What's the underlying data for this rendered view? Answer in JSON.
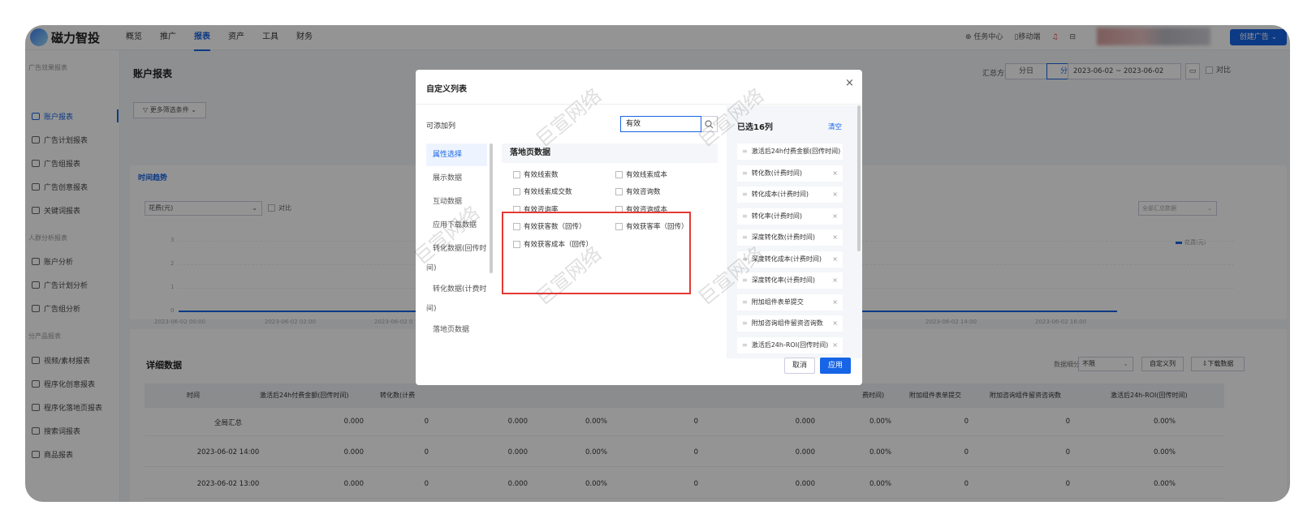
{
  "topbar": {
    "logo": "磁力智投",
    "nav": [
      "概览",
      "推广",
      "报表",
      "资产",
      "工具",
      "财务"
    ],
    "active_nav": "报表",
    "task_center": "任务中心",
    "mobile": "移动端",
    "create_ad": "创建广告"
  },
  "sidebar": {
    "sections": [
      "广告效果报表",
      "人群分析报表",
      "分产品报表"
    ],
    "items": [
      "账户报表",
      "广告计划报表",
      "广告组报表",
      "广告创意报表",
      "关键词报表",
      "账户分析",
      "广告计划分析",
      "广告组分析",
      "视频/素材报表",
      "程序化创意报表",
      "程序化落地页报表",
      "搜索词报表",
      "商品报表"
    ],
    "active": "账户报表"
  },
  "page": {
    "title": "账户报表",
    "summary_label": "汇总方式",
    "seg_day": "分日",
    "seg_hour": "分时",
    "date_start": "2023-06-02",
    "date_sep": "~",
    "date_end": "2023-06-02",
    "compare": "对比",
    "more_filters": "更多筛选条件"
  },
  "chart": {
    "tab": "时间趋势",
    "metric": "花费(元)",
    "compare": "对比",
    "right_select": "全部汇总数据",
    "legend": "花费(元)",
    "y_ticks": [
      "3",
      "2",
      "1",
      "0"
    ],
    "x_ticks": [
      "2023-06-02 00:00",
      "2023-06-02 02:00",
      "2023-06-02 0",
      "2023-06-02 14:00",
      "2023-06-02 16:00"
    ]
  },
  "chart_data": {
    "type": "line",
    "x": [
      "2023-06-02 00:00",
      "2023-06-02 02:00",
      "2023-06-02 14:00",
      "2023-06-02 16:00"
    ],
    "series": [
      {
        "name": "花费(元)",
        "values": [
          0,
          0,
          0,
          0
        ]
      }
    ],
    "ylim": [
      0,
      3
    ]
  },
  "detail": {
    "title": "详细数据",
    "granularity_label": "数据细分",
    "granularity_value": "不限",
    "custom_cols": "自定义列",
    "download": "下载数据",
    "headers": [
      "时间",
      "激活后24h付费金额(回传时间)",
      "转化数(计费",
      "费时间)",
      "附加组件表单提交",
      "附加咨询组件留资咨询数",
      "激活后24h-ROI(回传时间)"
    ],
    "rows": [
      [
        "全局汇总",
        "0.000",
        "0",
        "0.000",
        "0.00%",
        "0",
        "0.000",
        "0.00%",
        "0",
        "0",
        "0.00%"
      ],
      [
        "2023-06-02 14:00",
        "0.000",
        "0",
        "0.000",
        "0.00%",
        "0",
        "0.000",
        "0.00%",
        "0",
        "0",
        "0.00%"
      ],
      [
        "2023-06-02 13:00",
        "0.000",
        "0",
        "0.000",
        "0.00%",
        "0",
        "0.000",
        "0.00%",
        "0",
        "0",
        "0.00%"
      ]
    ]
  },
  "modal": {
    "title": "自定义列表",
    "available_label": "可添加列",
    "search_value": "有效",
    "categories": [
      "属性选择",
      "展示数据",
      "互动数据",
      "应用下载数据",
      "转化数据(回传时",
      "间)",
      "转化数据(计费时",
      "间)",
      "落地页数据"
    ],
    "group_title": "落地页数据",
    "options": [
      "有效线索数",
      "有效线索成本",
      "有效线索成交数",
      "有效咨询数",
      "有效咨询率",
      "有效咨询成本",
      "有效获客数（回传）",
      "有效获客率（回传）",
      "有效获客成本（回传）"
    ],
    "selected_title": "已选16列",
    "clear": "清空",
    "selected": [
      "激活后24h付费金额(回传时间)",
      "转化数(计费时间)",
      "转化成本(计费时间)",
      "转化率(计费时间)",
      "深度转化数(计费时间)",
      "深度转化成本(计费时间)",
      "深度转化率(计费时间)",
      "附加组件表单提交",
      "附加咨询组件留资咨询数",
      "激活后24h-ROI(回传时间)"
    ],
    "cancel": "取消",
    "apply": "应用"
  },
  "watermark": "巨宣网络"
}
